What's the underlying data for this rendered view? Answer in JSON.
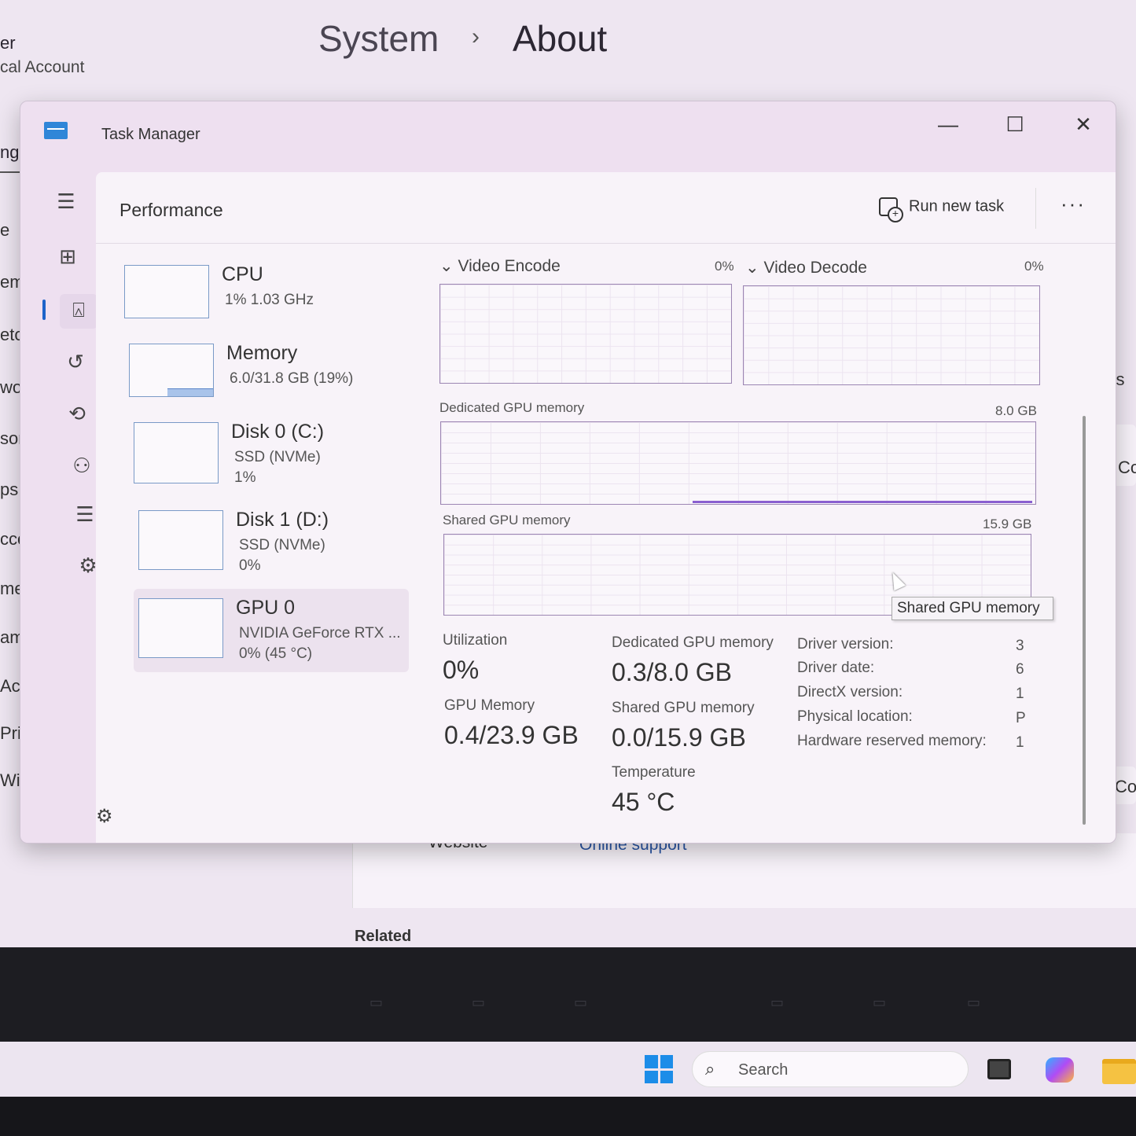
{
  "settings": {
    "breadcrumb": {
      "section": "System",
      "chevron": "›",
      "page": "About"
    },
    "account": {
      "name_fragment": "er",
      "type_fragment": "cal Account"
    },
    "search_fragment": "ng",
    "nav_fragments": [
      "e",
      "em",
      "etoot",
      "work",
      "sonal",
      "ps",
      "ccount",
      "me & l",
      "aming",
      "Accessib",
      "Privacy &",
      "Window"
    ],
    "right_fragments": {
      "settings": "ngs",
      "rename": "Co",
      "copy": "Copy"
    },
    "website_label": "Website",
    "online_support": "Online support",
    "related": "Related"
  },
  "taskmanager": {
    "title": "Task Manager",
    "window_controls": {
      "minimize": "—",
      "maximize": "☐",
      "close": "✕"
    },
    "page_title": "Performance",
    "run_new_task": "Run new task",
    "more": "···",
    "devices": [
      {
        "name": "CPU",
        "line1": "1%  1.03 GHz",
        "line2": ""
      },
      {
        "name": "Memory",
        "line1": "6.0/31.8 GB (19%)",
        "line2": ""
      },
      {
        "name": "Disk 0 (C:)",
        "line1": "SSD (NVMe)",
        "line2": "1%"
      },
      {
        "name": "Disk 1 (D:)",
        "line1": "SSD (NVMe)",
        "line2": "0%"
      },
      {
        "name": "GPU 0",
        "line1": "NVIDIA GeForce RTX ...",
        "line2": "0%  (45 °C)"
      }
    ],
    "graphs": {
      "video_encode": {
        "label": "Video Encode",
        "value": "0%"
      },
      "video_decode": {
        "label": "Video Decode",
        "value": "0%"
      },
      "dedicated": {
        "label": "Dedicated GPU memory",
        "max": "8.0 GB"
      },
      "shared": {
        "label": "Shared GPU memory",
        "max": "15.9 GB"
      }
    },
    "tooltip": "Shared GPU memory",
    "stats": {
      "utilization_label": "Utilization",
      "utilization": "0%",
      "gpu_memory_label": "GPU Memory",
      "gpu_memory": "0.4/23.9 GB",
      "dedicated_label": "Dedicated GPU memory",
      "dedicated": "0.3/8.0 GB",
      "shared_label": "Shared GPU memory",
      "shared": "0.0/15.9 GB",
      "temperature_label": "Temperature",
      "temperature": "45 °C"
    },
    "properties": [
      {
        "label": "Driver version:",
        "value": "3"
      },
      {
        "label": "Driver date:",
        "value": "6"
      },
      {
        "label": "DirectX version:",
        "value": "1"
      },
      {
        "label": "Physical location:",
        "value": "P"
      },
      {
        "label": "Hardware reserved memory:",
        "value": "1"
      }
    ]
  },
  "taskbar": {
    "search_placeholder": "Search"
  },
  "colors": {
    "accent": "#1d63c9",
    "graph_border": "#9c86b3",
    "gpu_line": "#8a5fd0",
    "windows_logo": "#1c8de8"
  },
  "icons": [
    "hamburger-icon",
    "processes-icon",
    "performance-icon",
    "app-history-icon",
    "startup-apps-icon",
    "users-icon",
    "details-icon",
    "services-icon",
    "settings-icon",
    "run-task-icon",
    "search-icon",
    "windows-start-icon",
    "task-view-icon",
    "copilot-icon",
    "file-explorer-icon"
  ]
}
